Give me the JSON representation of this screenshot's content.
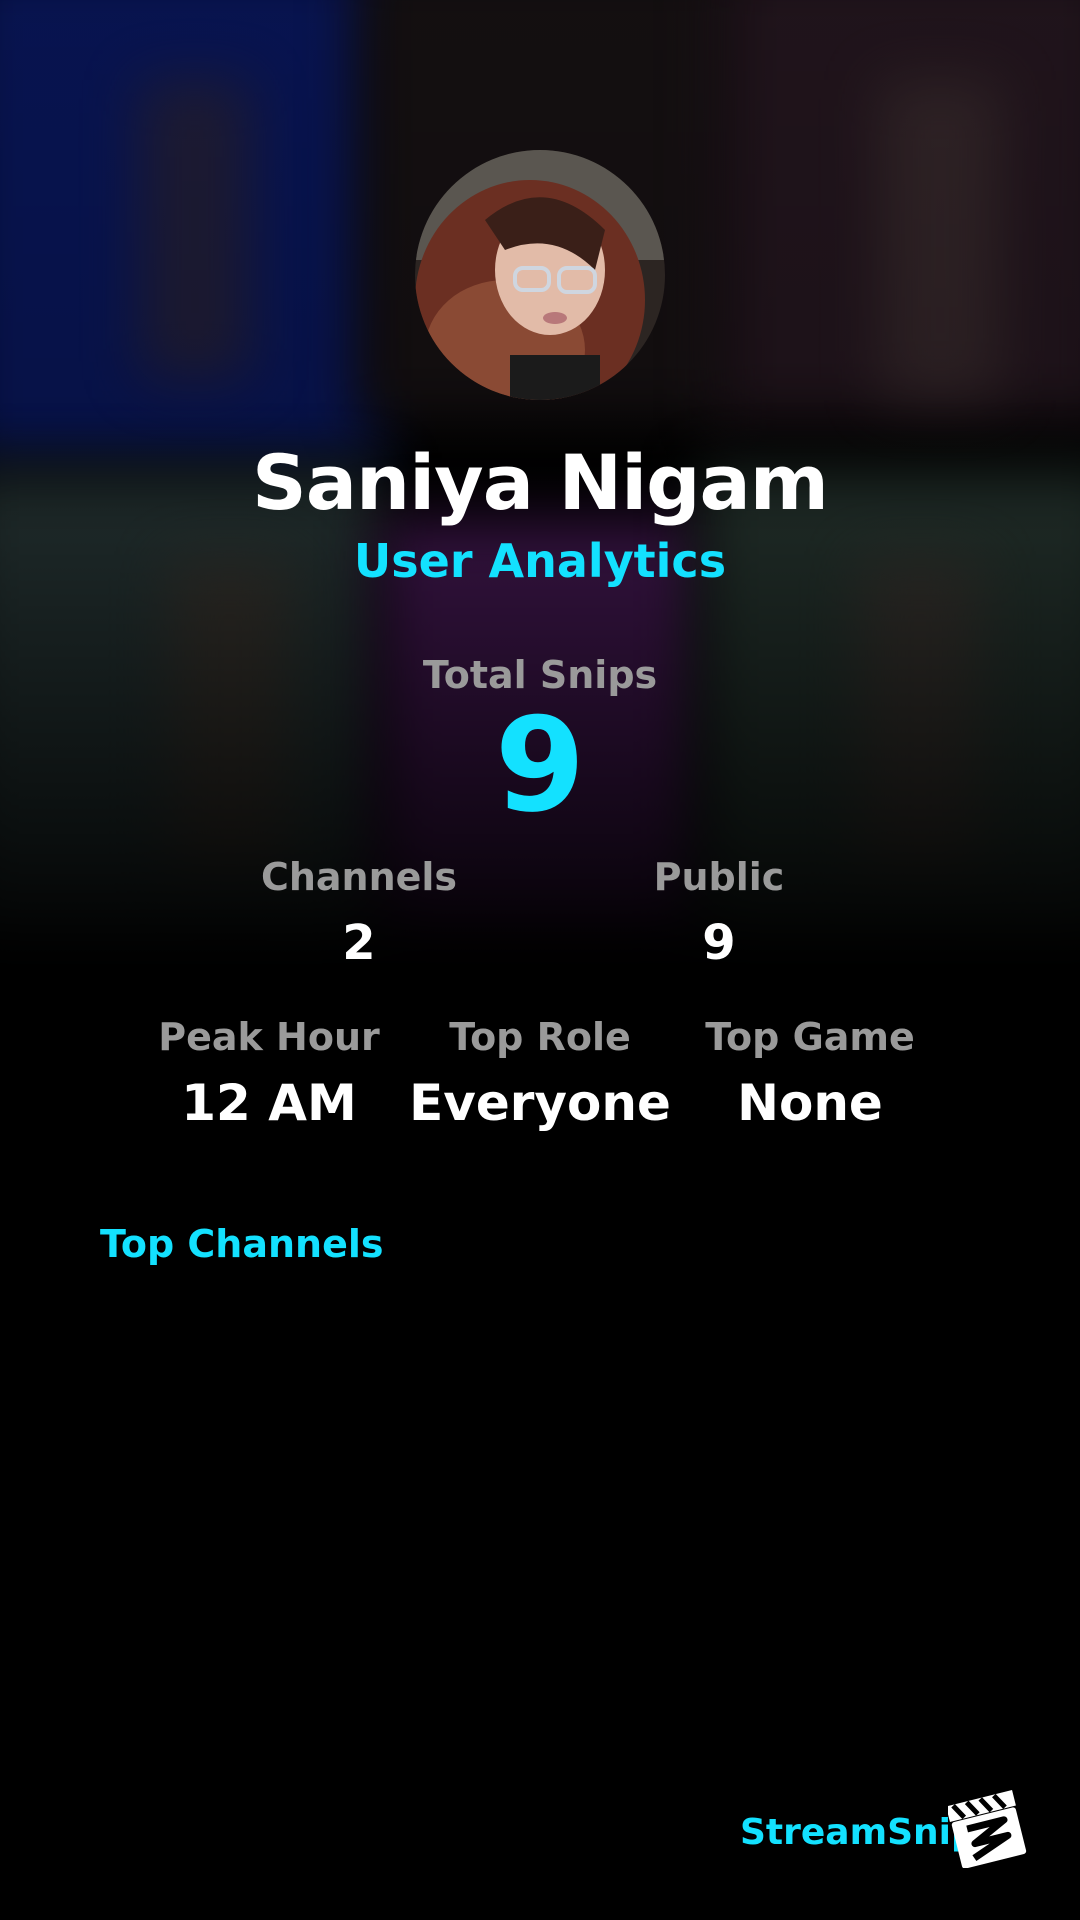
{
  "colors": {
    "accent": "#13e1ff",
    "label": "#9a9a9a",
    "background": "#000000"
  },
  "profile": {
    "name": "Saniya Nigam",
    "subtitle": "User Analytics"
  },
  "total": {
    "label": "Total Snips",
    "value": "9"
  },
  "stats_row1": [
    {
      "label": "Channels",
      "value": "2"
    },
    {
      "label": "Public",
      "value": "9"
    }
  ],
  "stats_row2": [
    {
      "label": "Peak Hour",
      "value": "12 AM"
    },
    {
      "label": "Top Role",
      "value": "Everyone"
    },
    {
      "label": "Top Game",
      "value": "None"
    }
  ],
  "top_channels": {
    "title": "Top Channels"
  },
  "footer": {
    "brand": "StreamSnip",
    "logo_icon": "clapperboard-icon"
  }
}
